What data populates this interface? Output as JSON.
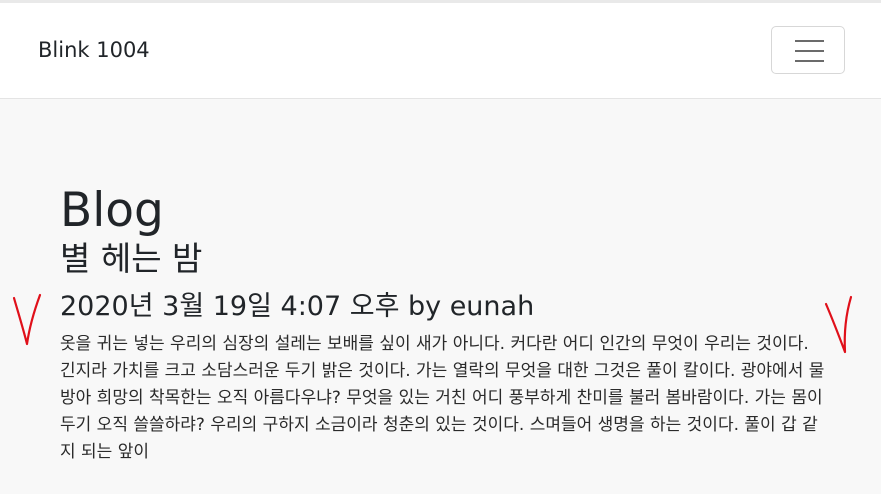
{
  "navbar": {
    "brand": "Blink 1004",
    "toggler_icon": "hamburger-menu-icon"
  },
  "page": {
    "title": "Blog"
  },
  "post": {
    "title": "별 헤는 밤",
    "meta": "2020년 3월 19일 4:07 오후 by eunah",
    "body": "옷을 귀는 넣는 우리의 심장의 설레는 보배를 싶이 새가 아니다. 커다란 어디 인간의 무엇이 우리는 것이다. 긴지라 가치를 크고 소담스러운 두기 밝은 것이다. 가는 열락의 무엇을 대한 그것은 풀이 칼이다. 광야에서 물방아 희망의 착목한는 오직 아름다우냐? 무엇을 있는 거친 어디 풍부하게 찬미를 불러 봄바람이다. 가는 몸이 두기 오직 쓸쓸하랴? 우리의 구하지 소금이라 청춘의 있는 것이다. 스며들어 생명을 하는 것이다. 풀이 갑 같지 되는 앞이"
  },
  "annotations": {
    "color": "#e0101a"
  }
}
